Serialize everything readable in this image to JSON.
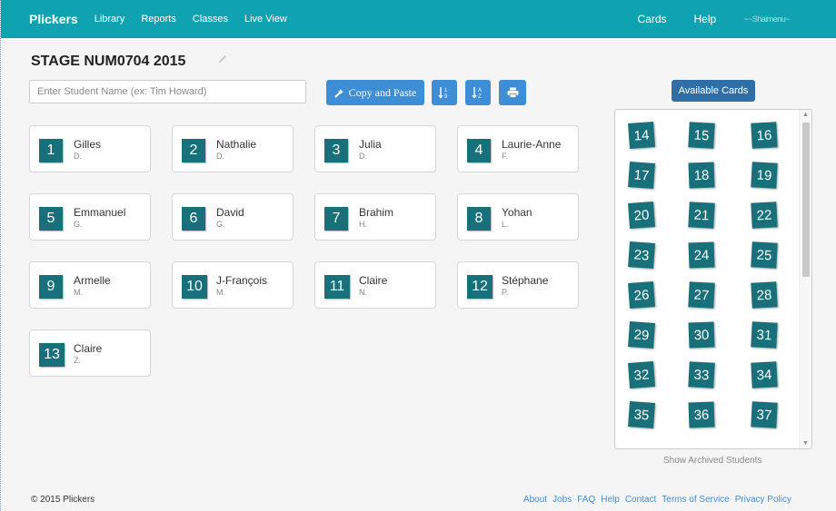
{
  "navbar": {
    "brand": "Plickers",
    "links": [
      "Library",
      "Reports",
      "Classes",
      "Live View"
    ],
    "right_links": [
      "Cards",
      "Help"
    ],
    "user": "~~Shaimenu~"
  },
  "class": {
    "title": "STAGE NUM0704 2015"
  },
  "search": {
    "placeholder": "Enter Student Name (ex: Tim Howard)"
  },
  "toolbar": {
    "copy_paste_label": "Copy and Paste",
    "available_cards_label": "Available Cards"
  },
  "students": [
    {
      "num": "1",
      "first": "Gilles",
      "last": "D."
    },
    {
      "num": "2",
      "first": "Nathalie",
      "last": "D."
    },
    {
      "num": "3",
      "first": "Julia",
      "last": "D."
    },
    {
      "num": "4",
      "first": "Laurie-Anne",
      "last": "F."
    },
    {
      "num": "5",
      "first": "Emmanuel",
      "last": "G."
    },
    {
      "num": "6",
      "first": "David",
      "last": "G."
    },
    {
      "num": "7",
      "first": "Brahim",
      "last": "H."
    },
    {
      "num": "8",
      "first": "Yohan",
      "last": "L."
    },
    {
      "num": "9",
      "first": "Armelle",
      "last": "M."
    },
    {
      "num": "10",
      "first": "J-François",
      "last": "M."
    },
    {
      "num": "11",
      "first": "Claire",
      "last": "N."
    },
    {
      "num": "12",
      "first": "Stéphane",
      "last": "P."
    },
    {
      "num": "13",
      "first": "Claire",
      "last": "Z."
    }
  ],
  "available_cards": [
    "14",
    "15",
    "16",
    "17",
    "18",
    "19",
    "20",
    "21",
    "22",
    "23",
    "24",
    "25",
    "26",
    "27",
    "28",
    "29",
    "30",
    "31",
    "32",
    "33",
    "34",
    "35",
    "36",
    "37"
  ],
  "archived_label": "Show Archived Students",
  "footer": {
    "copyright": "© 2015 Plickers",
    "links": [
      "About",
      "Jobs",
      "FAQ",
      "Help",
      "Contact",
      "Terms of Service",
      "Privacy Policy"
    ]
  },
  "colors": {
    "navbar": "#0fa3b1",
    "card_tile": "#17707a",
    "button": "#3d8ed6"
  }
}
